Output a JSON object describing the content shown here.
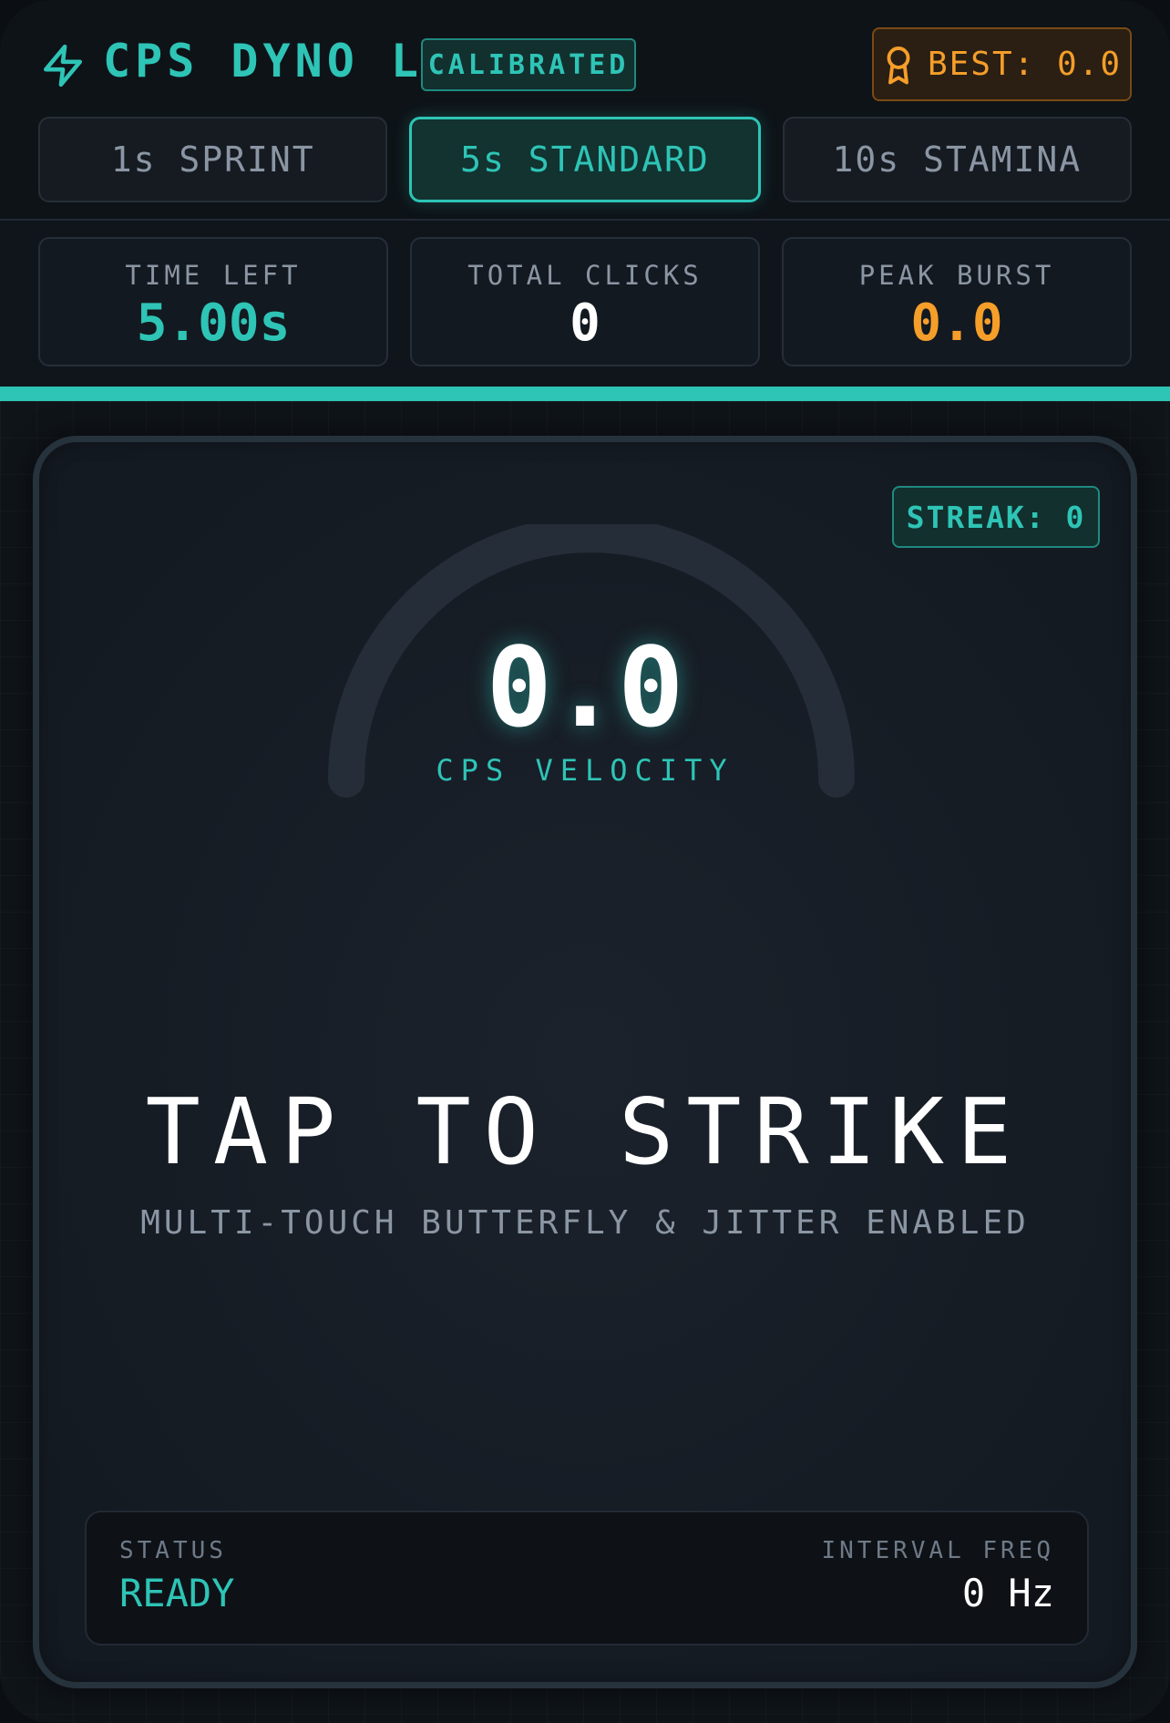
{
  "header": {
    "title": "CPS DYNO LAB",
    "calibrated_badge": "CALIBRATED",
    "best": {
      "label": "BEST: 0.0"
    },
    "icons": {
      "logo": "lightning-bolt-icon",
      "best": "award-icon"
    }
  },
  "mode_tabs": [
    {
      "label": "1s SPRINT",
      "active": false
    },
    {
      "label": "5s STANDARD",
      "active": true
    },
    {
      "label": "10s STAMINA",
      "active": false
    }
  ],
  "stats": {
    "time_left": {
      "label": "TIME LEFT",
      "value": "5.00s"
    },
    "total_clicks": {
      "label": "TOTAL CLICKS",
      "value": "0"
    },
    "peak_burst": {
      "label": "PEAK BURST",
      "value": "0.0"
    }
  },
  "progress": {
    "fraction": 1.0
  },
  "strike_pad": {
    "streak": "STREAK: 0",
    "gauge": {
      "value": "0.0",
      "label": "CPS VELOCITY",
      "fill_fraction": 0
    },
    "title": "TAP TO STRIKE",
    "subtitle": "MULTI-TOUCH BUTTERFLY & JITTER ENABLED",
    "status": {
      "label": "STATUS",
      "value": "READY"
    },
    "interval": {
      "label": "INTERVAL FREQ",
      "value": "0 Hz"
    }
  },
  "colors": {
    "accent": "#2ec4b6",
    "warning": "#f59e2a",
    "background": "#10151c"
  }
}
